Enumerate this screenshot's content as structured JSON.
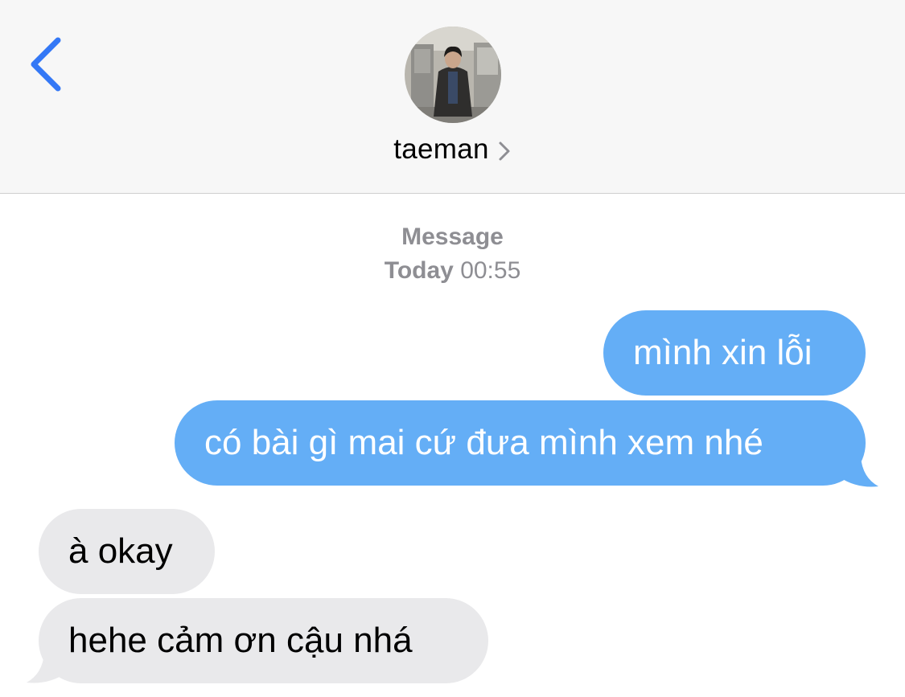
{
  "header": {
    "contact_name": "taeman",
    "avatar_alt": "contact photo"
  },
  "conversation": {
    "service_label": "Message",
    "timestamp_day": "Today",
    "timestamp_time": "00:55"
  },
  "messages": [
    {
      "direction": "sent",
      "text": "mình xin lỗi"
    },
    {
      "direction": "sent",
      "text": "có bài gì mai cứ đưa mình xem nhé"
    },
    {
      "direction": "received",
      "text": "à okay"
    },
    {
      "direction": "received",
      "text": "hehe cảm ơn cậu nhá"
    }
  ],
  "colors": {
    "sent_bubble": "#64aef6",
    "received_bubble": "#e9e9eb",
    "accent": "#3478f6"
  }
}
